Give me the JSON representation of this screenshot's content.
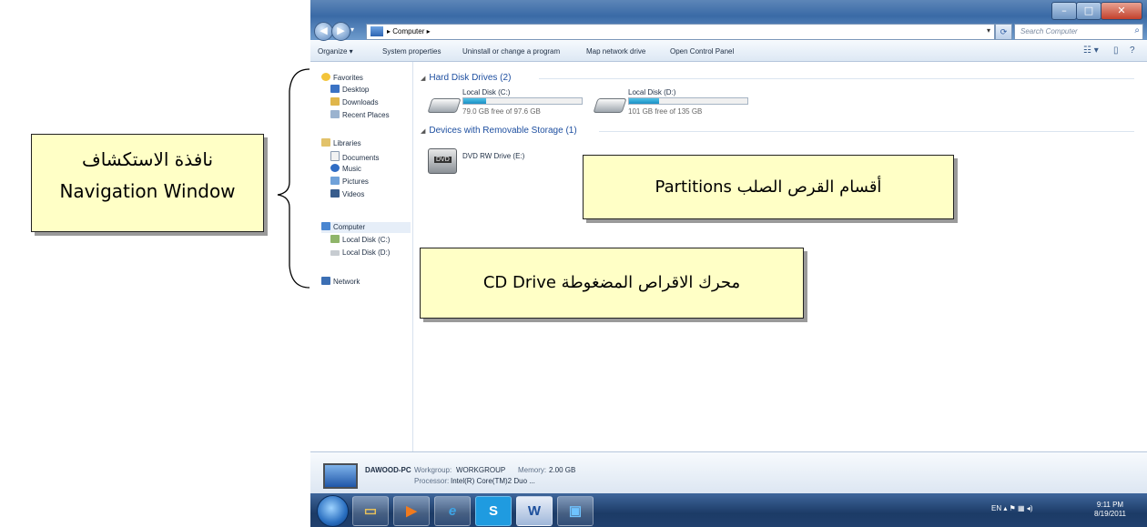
{
  "window": {
    "address": "Computer",
    "search_placeholder": "Search Computer"
  },
  "toolbar": {
    "organize": "Organize ▾",
    "system_properties": "System properties",
    "uninstall": "Uninstall or change a program",
    "map_drive": "Map network drive",
    "control_panel": "Open Control Panel"
  },
  "nav": {
    "favorites": "Favorites",
    "desktop": "Desktop",
    "downloads": "Downloads",
    "recent": "Recent Places",
    "libraries": "Libraries",
    "documents": "Documents",
    "music": "Music",
    "pictures": "Pictures",
    "videos": "Videos",
    "computer": "Computer",
    "local_c": "Local Disk (C:)",
    "local_d": "Local Disk (D:)",
    "network": "Network"
  },
  "content": {
    "hdd_group": "Hard Disk Drives (2)",
    "removable_group": "Devices with Removable Storage (1)",
    "drives": [
      {
        "name": "Local Disk (C:)",
        "free": "79.0 GB free of 97.6 GB",
        "used_fraction": 0.19
      },
      {
        "name": "Local Disk (D:)",
        "free": "101 GB free of 135 GB",
        "used_fraction": 0.25
      }
    ],
    "dvd": "DVD RW Drive (E:)",
    "dvd_label": "DVD"
  },
  "details": {
    "pc_name": "DAWOOD-PC",
    "workgroup_label": "Workgroup:",
    "workgroup": "WORKGROUP",
    "memory_label": "Memory:",
    "memory": "2.00 GB",
    "processor_label": "Processor:",
    "processor": "Intel(R) Core(TM)2 Duo ..."
  },
  "taskbar": {
    "lang": "EN",
    "time": "9:11 PM",
    "date": "8/19/2011",
    "skype": "S",
    "word": "W"
  },
  "annotations": {
    "nav_ar": "نافذة الاستكشاف",
    "nav_en": "Navigation Window",
    "partitions": "أقسام القرص الصلب Partitions",
    "cd": "محرك الاقراص المضغوطة CD Drive"
  },
  "colors": {
    "callout_bg": "#ffffc6",
    "title_bar": "#3a6aa6",
    "group_header": "#1e4fa0",
    "progress": "#1b8fc4"
  }
}
